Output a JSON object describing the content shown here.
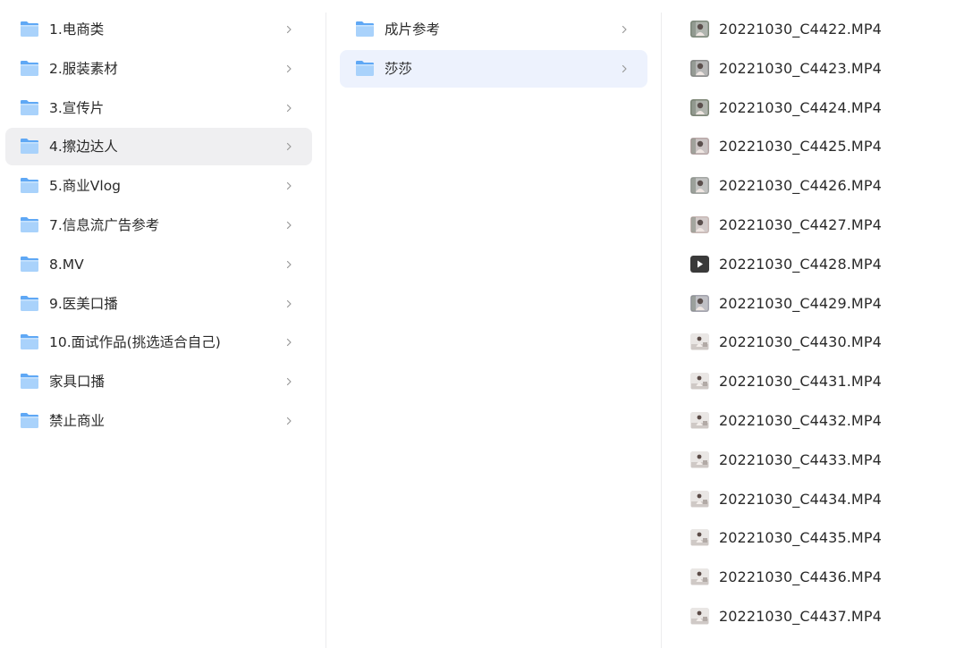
{
  "columns": [
    {
      "items": [
        {
          "label": "1.电商类"
        },
        {
          "label": "2.服装素材"
        },
        {
          "label": "3.宣传片"
        },
        {
          "label": "4.擦边达人"
        },
        {
          "label": "5.商业Vlog"
        },
        {
          "label": "7.信息流广告参考"
        },
        {
          "label": "8.MV"
        },
        {
          "label": "9.医美口播"
        },
        {
          "label": "10.面试作品(挑选适合自己)"
        },
        {
          "label": "家具口播"
        },
        {
          "label": "禁止商业"
        }
      ],
      "selected": "4.擦边达人"
    },
    {
      "items": [
        {
          "label": "成片参考"
        },
        {
          "label": "莎莎"
        }
      ],
      "selected": "莎莎"
    },
    {
      "items": [
        {
          "label": "20221030_C4422.MP4"
        },
        {
          "label": "20221030_C4423.MP4"
        },
        {
          "label": "20221030_C4424.MP4"
        },
        {
          "label": "20221030_C4425.MP4"
        },
        {
          "label": "20221030_C4426.MP4"
        },
        {
          "label": "20221030_C4427.MP4"
        },
        {
          "label": "20221030_C4428.MP4"
        },
        {
          "label": "20221030_C4429.MP4"
        },
        {
          "label": "20221030_C4430.MP4"
        },
        {
          "label": "20221030_C4431.MP4"
        },
        {
          "label": "20221030_C4432.MP4"
        },
        {
          "label": "20221030_C4433.MP4"
        },
        {
          "label": "20221030_C4434.MP4"
        },
        {
          "label": "20221030_C4435.MP4"
        },
        {
          "label": "20221030_C4436.MP4"
        },
        {
          "label": "20221030_C4437.MP4"
        }
      ]
    }
  ],
  "icons": {
    "folder": "folder-icon",
    "chevron": "chevron-right-icon",
    "video_thumb": "video-thumbnail-icon",
    "play": "play-icon"
  },
  "colors": {
    "folder_light": "#a9d2fb",
    "folder_dark": "#5fa8f5",
    "selected_gray": "#efeff1",
    "selected_blue": "#edf2fd",
    "chevron": "#9a9a9a"
  }
}
